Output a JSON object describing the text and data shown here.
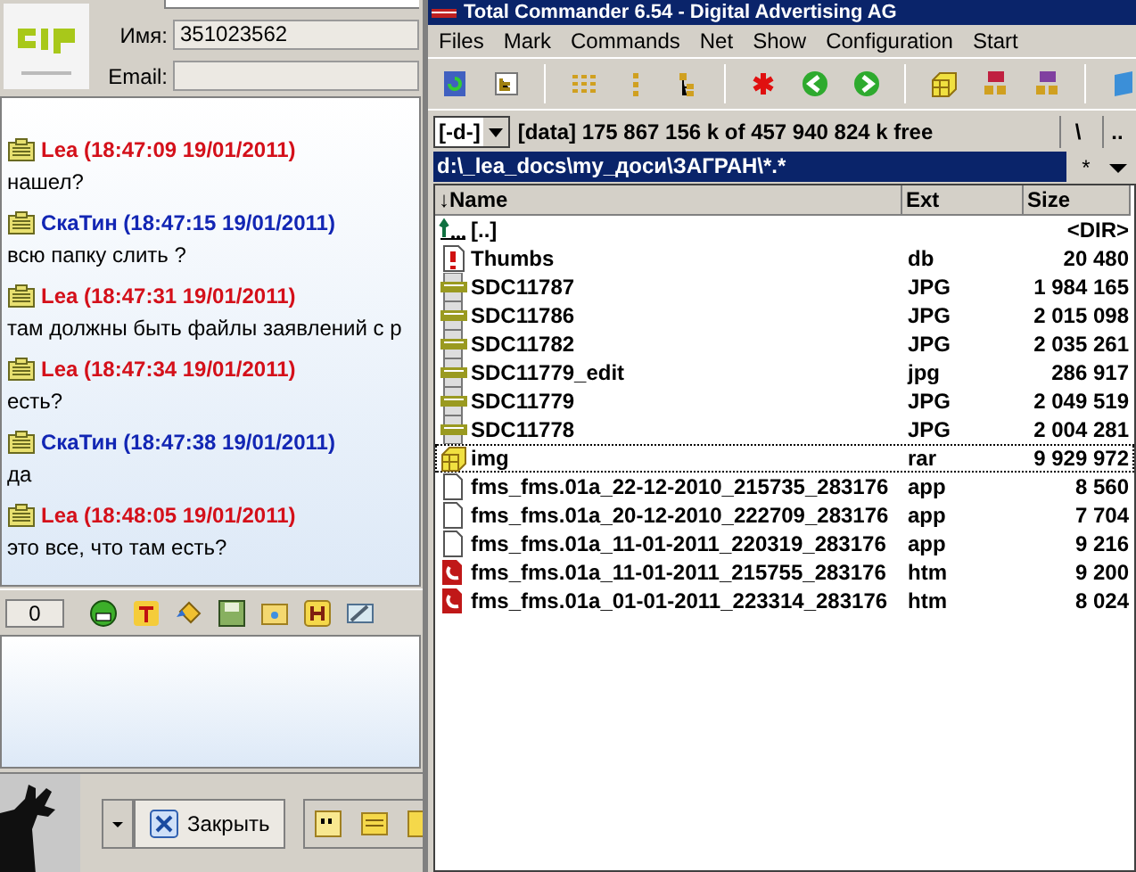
{
  "chat_window": {
    "contact": {
      "name_label": "Имя:",
      "name_value": "351023562",
      "email_label": "Email:"
    },
    "messages": [
      {
        "author": "Lea (18:47:09 19/01/2011)",
        "text": "нашел?",
        "color": "#d4101a"
      },
      {
        "author": "СкаТин (18:47:15 19/01/2011)",
        "text": "всю папку слить ?",
        "color": "#1226b4"
      },
      {
        "author": "Lea (18:47:31 19/01/2011)",
        "text": "там должны быть файлы заявлений с р",
        "color": "#d4101a"
      },
      {
        "author": "Lea (18:47:34 19/01/2011)",
        "text": "есть?",
        "color": "#d4101a"
      },
      {
        "author": "СкаТин (18:47:38 19/01/2011)",
        "text": "да",
        "color": "#1226b4"
      },
      {
        "author": "Lea (18:48:05 19/01/2011)",
        "text": "это все, что там есть?",
        "color": "#d4101a"
      }
    ],
    "char_count": "0",
    "close_button": "Закрыть"
  },
  "commander": {
    "title": "Total Commander 6.54 - Digital Advertising AG",
    "menu": [
      "Files",
      "Mark",
      "Commands",
      "Net",
      "Show",
      "Configuration",
      "Start"
    ],
    "drive": "[-d-]",
    "free_space": "[data]  175 867 156 k of 457 940 824 k free",
    "root_button": "\\",
    "up_button": "..",
    "path": "d:\\_lea_docs\\my_доcи\\ЗАГРАН\\*.*",
    "filter_button": "*",
    "columns": [
      "↓Name",
      "Ext",
      "Size"
    ],
    "files": [
      {
        "kind": "up",
        "name": "[..]",
        "size": "<DIR>",
        "focused": false
      },
      {
        "kind": "warning",
        "name": "Thumbs",
        "ext": "db",
        "size": "20 480",
        "focused": false
      },
      {
        "kind": "jpg",
        "name": "SDC11787",
        "ext": "JPG",
        "size": "1 984 165",
        "focused": false
      },
      {
        "kind": "jpg",
        "name": "SDC11786",
        "ext": "JPG",
        "size": "2 015 098",
        "focused": false
      },
      {
        "kind": "jpg",
        "name": "SDC11782",
        "ext": "JPG",
        "size": "2 035 261",
        "focused": false
      },
      {
        "kind": "jpg",
        "name": "SDC11779_edit",
        "ext": "jpg",
        "size": "286 917",
        "focused": false
      },
      {
        "kind": "jpg",
        "name": "SDC11779",
        "ext": "JPG",
        "size": "2 049 519",
        "focused": false
      },
      {
        "kind": "jpg",
        "name": "SDC11778",
        "ext": "JPG",
        "size": "2 004 281",
        "focused": false
      },
      {
        "kind": "archive",
        "name": "img",
        "ext": "rar",
        "size": "9 929 972",
        "focused": true
      },
      {
        "kind": "file",
        "name": "fms_fms.01a_22-12-2010_215735_283176",
        "ext": "app",
        "size": "8 560",
        "focused": false
      },
      {
        "kind": "file",
        "name": "fms_fms.01a_20-12-2010_222709_283176",
        "ext": "app",
        "size": "7 704",
        "focused": false
      },
      {
        "kind": "file",
        "name": "fms_fms.01a_11-01-2011_220319_283176",
        "ext": "app",
        "size": "9 216",
        "focused": false
      },
      {
        "kind": "htm",
        "name": "fms_fms.01a_11-01-2011_215755_283176",
        "ext": "htm",
        "size": "9 200",
        "focused": false
      },
      {
        "kind": "htm",
        "name": "fms_fms.01a_01-01-2011_223314_283176",
        "ext": "htm",
        "size": "8 024",
        "focused": false
      }
    ]
  }
}
